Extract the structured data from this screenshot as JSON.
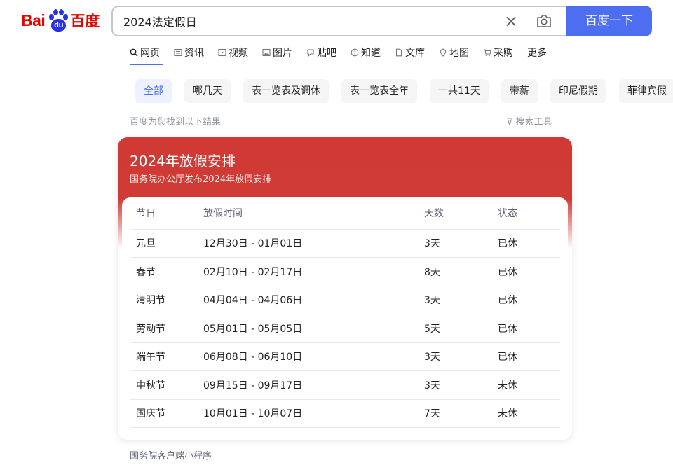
{
  "logo": {
    "text_bai": "Bai",
    "text_du": "du",
    "text_baidu": "百度"
  },
  "search": {
    "query": "2024法定假日",
    "button_label": "百度一下"
  },
  "tabs": [
    {
      "label": "网页",
      "icon": "search-icon"
    },
    {
      "label": "资讯",
      "icon": "news-icon"
    },
    {
      "label": "视频",
      "icon": "video-icon"
    },
    {
      "label": "图片",
      "icon": "image-icon"
    },
    {
      "label": "贴吧",
      "icon": "tieba-icon"
    },
    {
      "label": "知道",
      "icon": "question-icon"
    },
    {
      "label": "文库",
      "icon": "document-icon"
    },
    {
      "label": "地图",
      "icon": "map-icon"
    },
    {
      "label": "采购",
      "icon": "cart-icon"
    },
    {
      "label": "更多",
      "icon": ""
    }
  ],
  "chips": [
    "全部",
    "哪几天",
    "表一览表及调休",
    "表一览表全年",
    "一共11天",
    "带薪",
    "印尼假期",
    "菲律宾假"
  ],
  "result_info": "百度为您找到以下结果",
  "tools_label": "搜索工具",
  "card": {
    "title": "2024年放假安排",
    "subtitle": "国务院办公厅发布2024年放假安排",
    "headers": [
      "节日",
      "放假时间",
      "天数",
      "状态"
    ],
    "rows": [
      [
        "元旦",
        "12月30日 - 01月01日",
        "3天",
        "已休"
      ],
      [
        "春节",
        "02月10日 - 02月17日",
        "8天",
        "已休"
      ],
      [
        "清明节",
        "04月04日 - 04月06日",
        "3天",
        "已休"
      ],
      [
        "劳动节",
        "05月01日 - 05月05日",
        "5天",
        "已休"
      ],
      [
        "端午节",
        "06月08日 - 06月10日",
        "3天",
        "已休"
      ],
      [
        "中秋节",
        "09月15日 - 09月17日",
        "3天",
        "未休"
      ],
      [
        "国庆节",
        "10月01日 - 10月07日",
        "7天",
        "未休"
      ]
    ]
  },
  "source": "国务院客户端小程序",
  "colors": {
    "brand_blue": "#4e6ef2",
    "brand_red": "#d13a34",
    "logo_red": "#e10602",
    "logo_blue": "#2932e1"
  }
}
